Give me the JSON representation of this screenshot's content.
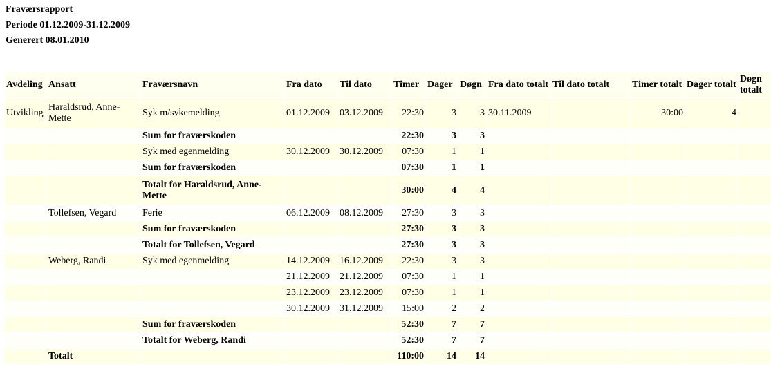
{
  "report": {
    "title": "Fraværsrapport",
    "period": "Periode 01.12.2009-31.12.2009",
    "generated": "Generert 08.01.2010"
  },
  "columns": {
    "avdeling": "Avdeling",
    "ansatt": "Ansatt",
    "fravaersnavn": "Fraværsnavn",
    "fra_dato": "Fra dato",
    "til_dato": "Til dato",
    "timer": "Timer",
    "dager": "Dager",
    "dogn": "Døgn",
    "fra_dato_totalt": "Fra dato totalt",
    "til_dato_totalt": "Til dato totalt",
    "timer_totalt": "Timer totalt",
    "dager_totalt": "Dager totalt",
    "dogn_totalt": "Døgn totalt"
  },
  "rows": [
    {
      "avd": "Utvikling",
      "ans": "Haraldsrud, Anne-Mette",
      "navn": "Syk m/sykemelding",
      "fra": "01.12.2009",
      "til": "03.12.2009",
      "timer": "22:30",
      "dager": "3",
      "dogn": "3",
      "fra_t": "30.11.2009",
      "til_t": "",
      "timer_t": "30:00",
      "dager_t": "4",
      "dogn_t": "4"
    },
    {
      "navn": "Sum for fraværskoden",
      "timer": "22:30",
      "dager": "3",
      "dogn": "3"
    },
    {
      "navn": "Syk med egenmelding",
      "fra": "30.12.2009",
      "til": "30.12.2009",
      "timer": "07:30",
      "dager": "1",
      "dogn": "1"
    },
    {
      "navn": "Sum for fraværskoden",
      "timer": "07:30",
      "dager": "1",
      "dogn": "1"
    },
    {
      "navn": "Totalt for Haraldsrud, Anne-Mette",
      "timer": "30:00",
      "dager": "4",
      "dogn": "4"
    },
    {
      "ans": "Tollefsen, Vegard",
      "navn": "Ferie",
      "fra": "06.12.2009",
      "til": "08.12.2009",
      "timer": "27:30",
      "dager": "3",
      "dogn": "3"
    },
    {
      "navn": "Sum for fraværskoden",
      "timer": "27:30",
      "dager": "3",
      "dogn": "3"
    },
    {
      "navn": "Totalt for Tollefsen, Vegard",
      "timer": "27:30",
      "dager": "3",
      "dogn": "3"
    },
    {
      "ans": "Weberg, Randi",
      "navn": "Syk med egenmelding",
      "fra": "14.12.2009",
      "til": "16.12.2009",
      "timer": "22:30",
      "dager": "3",
      "dogn": "3"
    },
    {
      "fra": "21.12.2009",
      "til": "21.12.2009",
      "timer": "07:30",
      "dager": "1",
      "dogn": "1"
    },
    {
      "fra": "23.12.2009",
      "til": "23.12.2009",
      "timer": "07:30",
      "dager": "1",
      "dogn": "1"
    },
    {
      "fra": "30.12.2009",
      "til": "31.12.2009",
      "timer": "15:00",
      "dager": "2",
      "dogn": "2"
    },
    {
      "navn": "Sum for fraværskoden",
      "timer": "52:30",
      "dager": "7",
      "dogn": "7"
    },
    {
      "navn": "Totalt for Weberg, Randi",
      "timer": "52:30",
      "dager": "7",
      "dogn": "7"
    },
    {
      "ans": "Totalt",
      "timer": "110:00",
      "dager": "14",
      "dogn": "14"
    }
  ],
  "colors": {
    "row_a": "#ffffe6",
    "row_b": "#fffffa"
  }
}
